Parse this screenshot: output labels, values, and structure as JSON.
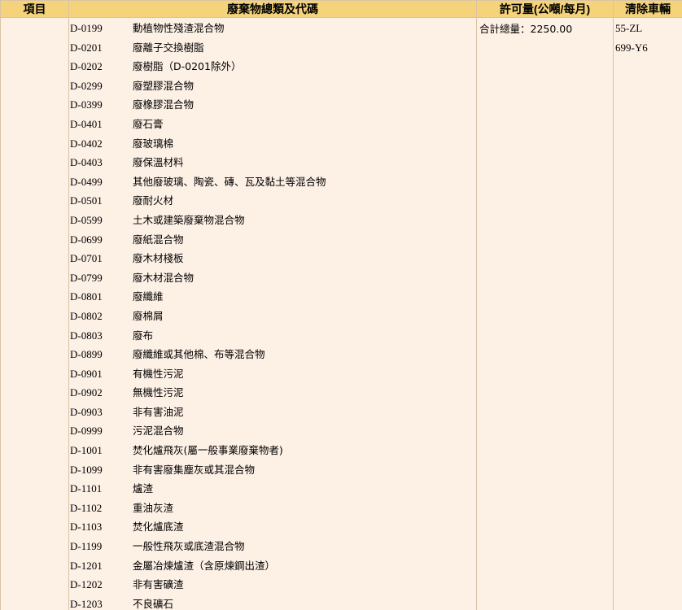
{
  "headers": {
    "item": "項目",
    "waste_type": "廢棄物總類及代碼",
    "permit_amount": "許可量(公噸/每月)",
    "vehicles": "清除車輛"
  },
  "permit": {
    "total_label": "合計總量",
    "total_value": "2250.00",
    "total_text": "合計總量：2250.00"
  },
  "vehicles": [
    "55-ZL",
    "699-Y6"
  ],
  "waste_items": [
    {
      "code": "D-0199",
      "name": "動植物性殘渣混合物"
    },
    {
      "code": "D-0201",
      "name": "廢離子交換樹脂"
    },
    {
      "code": "D-0202",
      "name": "廢樹脂（D-0201除外）"
    },
    {
      "code": "D-0299",
      "name": "廢塑膠混合物"
    },
    {
      "code": "D-0399",
      "name": "廢橡膠混合物"
    },
    {
      "code": "D-0401",
      "name": "廢石膏"
    },
    {
      "code": "D-0402",
      "name": "廢玻璃棉"
    },
    {
      "code": "D-0403",
      "name": "廢保溫材料"
    },
    {
      "code": "D-0499",
      "name": "其他廢玻璃、陶瓷、磚、瓦及黏土等混合物"
    },
    {
      "code": "D-0501",
      "name": "廢耐火材"
    },
    {
      "code": "D-0599",
      "name": "土木或建築廢棄物混合物"
    },
    {
      "code": "D-0699",
      "name": "廢紙混合物"
    },
    {
      "code": "D-0701",
      "name": "廢木材棧板"
    },
    {
      "code": "D-0799",
      "name": "廢木材混合物"
    },
    {
      "code": "D-0801",
      "name": "廢纖維"
    },
    {
      "code": "D-0802",
      "name": "廢棉屑"
    },
    {
      "code": "D-0803",
      "name": "廢布"
    },
    {
      "code": "D-0899",
      "name": "廢纖維或其他棉、布等混合物"
    },
    {
      "code": "D-0901",
      "name": "有機性污泥"
    },
    {
      "code": "D-0902",
      "name": "無機性污泥"
    },
    {
      "code": "D-0903",
      "name": "非有害油泥"
    },
    {
      "code": "D-0999",
      "name": "污泥混合物"
    },
    {
      "code": "D-1001",
      "name": "焚化爐飛灰(屬一般事業廢棄物者)"
    },
    {
      "code": "D-1099",
      "name": "非有害廢集塵灰或其混合物"
    },
    {
      "code": "D-1101",
      "name": "爐渣"
    },
    {
      "code": "D-1102",
      "name": "重油灰渣"
    },
    {
      "code": "D-1103",
      "name": "焚化爐底渣"
    },
    {
      "code": "D-1199",
      "name": "一般性飛灰或底渣混合物"
    },
    {
      "code": "D-1201",
      "name": "金屬冶煉爐渣（含原煉鋼出渣）"
    },
    {
      "code": "D-1202",
      "name": "非有害礦渣"
    },
    {
      "code": "D-1203",
      "name": "不良礦石"
    }
  ]
}
